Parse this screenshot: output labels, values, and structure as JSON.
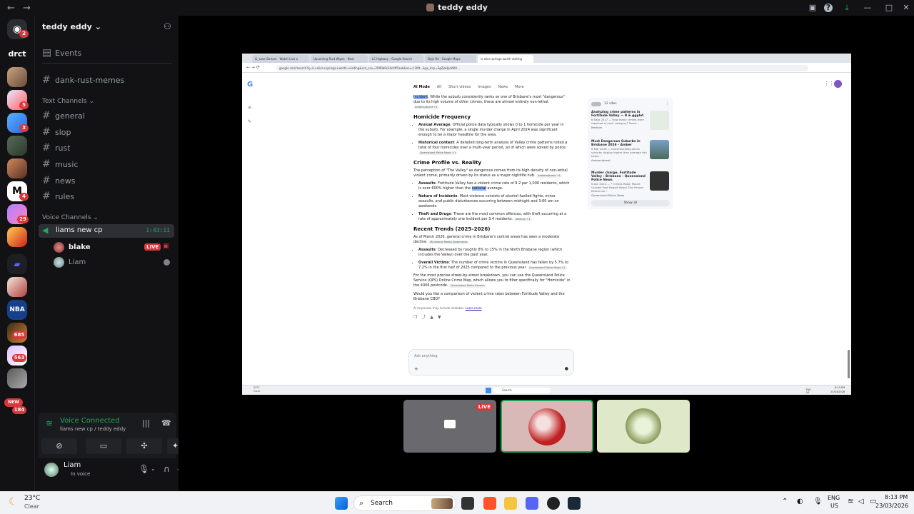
{
  "titlebar": {
    "title": "teddy eddy"
  },
  "server_badges": [
    "2",
    "5",
    "3",
    "4",
    "29",
    "685",
    "563",
    "NEW",
    "184"
  ],
  "server_labels": {
    "drct": "drct",
    "nba": "NBA"
  },
  "sidebar": {
    "server_name": "teddy eddy",
    "events": "Events",
    "pinned_channel": "dank-rust-memes",
    "text_category": "Text Channels",
    "text_channels": [
      "general",
      "slop",
      "rust",
      "music",
      "news",
      "rules"
    ],
    "voice_category": "Voice Channels",
    "voice_channel": {
      "name": "liams new cp",
      "timer": "1:43:11"
    },
    "voice_users": [
      {
        "name": "blake",
        "live": "LIVE"
      },
      {
        "name": "Liam"
      }
    ]
  },
  "voice_panel": {
    "status": "Voice Connected",
    "location": "liams new cp / teddy eddy"
  },
  "user": {
    "name": "Liam",
    "status": "In voice"
  },
  "browser": {
    "tabs": [
      "LI_save Stream - Watch Live o",
      "Upcoming Rust Wipes - Next",
      "LC highway - Google Search",
      "Dojo Rd - Google Maps",
      "is alice springs worth visiting"
    ],
    "url": "google.com/search?q=is+alice+springs+worth+visiting&sca_esv=2990b0c2dc4ff5aeb&oei=f-3Mt...&gs_lcrp=EgZjaHJvbWU...",
    "search_tabs": [
      "AI Mode",
      "All",
      "Short videos",
      "Images",
      "News",
      "More"
    ],
    "article": {
      "intro_highlight": "Incident",
      "intro": ". While the suburb consistently ranks as one of Brisbane's most \"dangerous\" due to its high volume of other crimes, these are almost entirely non-lethal.",
      "intro_chip": "Ambersiduent +1",
      "h1": "Homicide Frequency",
      "h1_items": [
        {
          "lead": "Annual Average",
          "text": ": Official police data typically shows 0 to 1 homicide per year in the suburb. For example, a single murder charge in April 2024 was significant enough to be a major headline for the area."
        },
        {
          "lead": "Historical context",
          "text": ": A detailed long-term analysis of Valley crime patterns noted a total of four homicides over a multi-year period, all of which were solved by police.",
          "chip": "Queensland Police News +1"
        }
      ],
      "h2": "Crime Profile vs. Reality",
      "h2_intro": "The perception of \"The Valley\" as dangerous comes from its high density of non-lethal violent crime, primarily driven by its status as a major nightlife hub.",
      "h2_chip": "Ambersiduent +1",
      "h2_items": [
        {
          "lead": "Assaults",
          "text": ": Fortitude Valley has a violent crime rate of 9.2 per 1,000 residents, which is over 600% higher than the ",
          "hl": "national",
          "tail": " average."
        },
        {
          "lead": "Nature of Incidents",
          "text": ": Most violence consists of alcohol-fuelled fights, minor assaults, and public disturbances occurring between midnight and 3:00 am on weekends."
        },
        {
          "lead": "Theft and Drugs",
          "text": ": These are the most common offences, with theft occurring at a rate of approximately one incident per 3.4 residents.",
          "chip": "Medium +1"
        }
      ],
      "h3": "Recent Trends (2025–2026)",
      "h3_intro": "As of March 2026, general crime in Brisbane's central areas has seen a moderate decline.",
      "h3_chip": "Ministerial Media Statements",
      "h3_items": [
        {
          "lead": "Assaults",
          "text": ": Decreased by roughly 8% to 15% in the North Brisbane region (which includes the Valley) over the past year."
        },
        {
          "lead": "Overall Victims",
          "text": ": The number of crime victims in Queensland has fallen by 5.7% to 7.2% in the first half of 2025 compared to the previous year.",
          "chip": "Queensland Police News +2"
        }
      ],
      "outro": "For the most precise street-by-street breakdown, you can use the Queensland Police Service (QPS) Online Crime Map, which allows you to filter specifically for \"Homicide\" in the 4006 postcode.",
      "outro_chip": "Queensland Police Service",
      "question": "Would you like a comparison of violent crime rates between Fortitude Valley and the Brisbane CBD?",
      "disclaimer": "AI responses may include mistakes.",
      "learn_more": "Learn more",
      "ask_placeholder": "Ask anything"
    },
    "sources": {
      "count": "12 sites",
      "items": [
        {
          "title": "Analyzing crime patterns in Fortitude Valley — R & ggplot",
          "desc": "6 Sept 2017 — How many crimes were reported of each category? Some...",
          "site": "Medium"
        },
        {
          "title": "Most Dangerous Suburbs in Brisbane 2026 - Amber",
          "desc": "6 Mar 2026 — Understanding which suburbs display higher than average risk helps...",
          "site": "Ambersiduent"
        },
        {
          "title": "Murder charge, Fortitude Valley - Brisbane - Queensland Police News",
          "desc": "6 Apr 2024 — * Crimes Road, Mount Gravatt East Report About This Person. Reference...",
          "site": "Queensland Police News"
        }
      ],
      "show_all": "Show all"
    },
    "inner_taskbar": {
      "weather": "23°C",
      "cond": "Clear",
      "search": "Search",
      "time": "8:13 PM",
      "date": "23/03/2026",
      "lang": "ENG\nUS"
    }
  },
  "stream_tiles": {
    "live_label": "LIVE"
  },
  "taskbar": {
    "weather_temp": "23°C",
    "weather_cond": "Clear",
    "search": "Search",
    "lang": "ENG",
    "region": "US",
    "time": "8:13 PM",
    "date": "23/03/2026"
  }
}
